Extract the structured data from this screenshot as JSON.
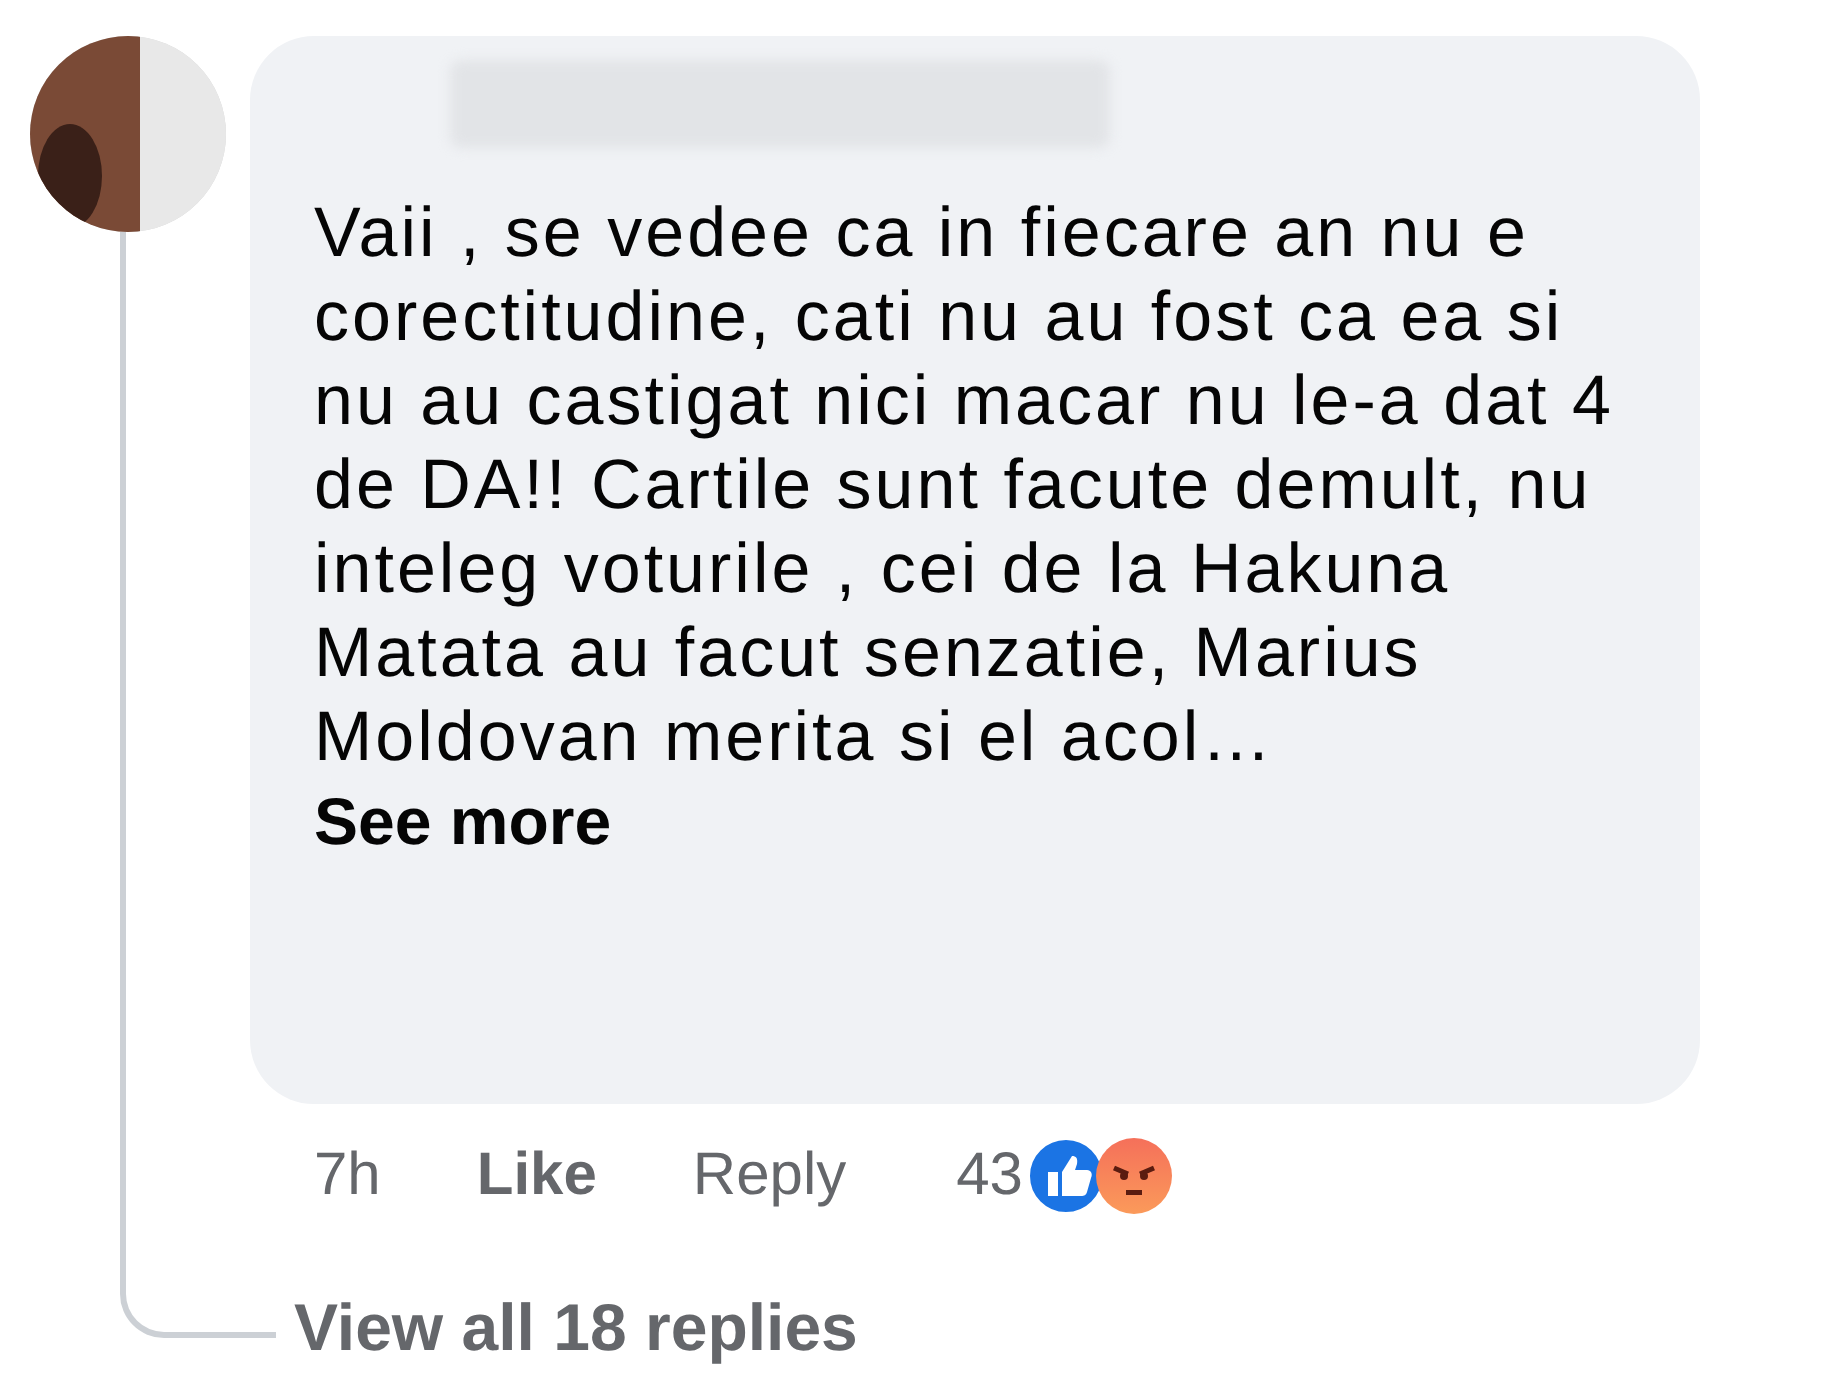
{
  "comment": {
    "text": "Vaii , se vedee ca in fiecare an nu e corectitudine, cati nu au fost ca ea si nu au castigat nici macar nu le-a dat 4 de DA!! Cartile sunt facute demult, nu inteleg voturile , cei de la Hakuna Matata au facut senzatie, Marius Moldovan merita si el acol…",
    "see_more": "See more",
    "time": "7h",
    "actions": [
      "Like",
      "Reply"
    ],
    "reaction_count": "43",
    "reactions": [
      {
        "kind": "like"
      },
      {
        "kind": "angry"
      }
    ]
  },
  "replies_link": "View all 18 replies"
}
